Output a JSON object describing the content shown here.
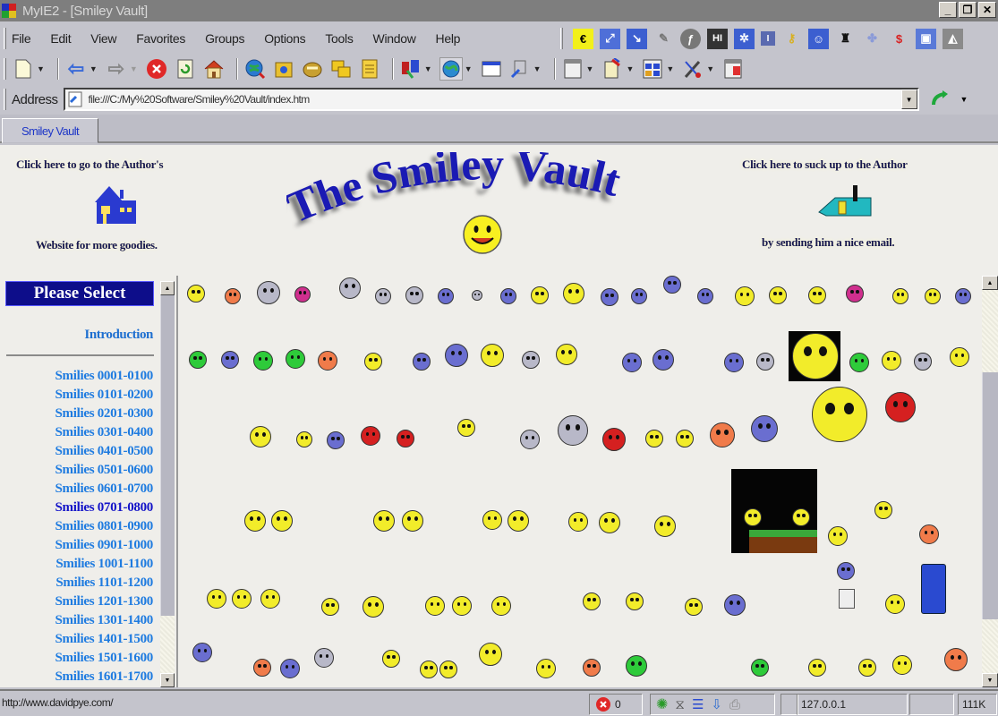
{
  "window": {
    "title": "MyIE2 - [Smiley Vault]",
    "controls": {
      "minimize": "_",
      "restore": "❐",
      "close": "✕"
    }
  },
  "menubar": {
    "items": [
      {
        "label": "File",
        "accel": "F"
      },
      {
        "label": "Edit",
        "accel": "E"
      },
      {
        "label": "View",
        "accel": "V"
      },
      {
        "label": "Favorites",
        "accel": "a"
      },
      {
        "label": "Groups",
        "accel": "G"
      },
      {
        "label": "Options",
        "accel": "O"
      },
      {
        "label": "Tools",
        "accel": "T"
      },
      {
        "label": "Window",
        "accel": "W"
      },
      {
        "label": "Help",
        "accel": "H"
      }
    ],
    "extension_icons": [
      "euro-icon",
      "resize-icon",
      "arrow-icon",
      "mouse-icon",
      "flash-icon",
      "hi-icon",
      "network-icon",
      "info-icon",
      "key-icon",
      "user-icon",
      "spy-icon",
      "puzzle-icon",
      "script-icon",
      "image-icon",
      "proxy-icon"
    ]
  },
  "toolbar": {
    "buttons": [
      "new-window",
      "back",
      "forward",
      "stop",
      "refresh",
      "home",
      "search",
      "favorites",
      "history",
      "groups",
      "notes",
      "popup-filter",
      "web",
      "window-layout",
      "tools",
      "new-tab",
      "view-options",
      "tile",
      "properties",
      "close-tab"
    ]
  },
  "address": {
    "label": "Address",
    "value": "file:///C:/My%20Software/Smiley%20Vault/index.htm"
  },
  "tabs": [
    {
      "label": "Smiley Vault",
      "active": true
    }
  ],
  "page": {
    "left_blurb_top": "Click here to go to the Author's",
    "left_blurb_bottom": "Website for more goodies.",
    "right_blurb_top": "Click here to suck up to the Author",
    "right_blurb_bottom": "by sending him a nice email.",
    "logo_text": "The Smiley Vault",
    "nav": {
      "header": "Please Select",
      "intro": "Introduction",
      "items": [
        {
          "label": "Smilies 0001-0100",
          "visited": false
        },
        {
          "label": "Smilies 0101-0200",
          "visited": false
        },
        {
          "label": "Smilies 0201-0300",
          "visited": false
        },
        {
          "label": "Smilies 0301-0400",
          "visited": false
        },
        {
          "label": "Smilies 0401-0500",
          "visited": false
        },
        {
          "label": "Smilies 0501-0600",
          "visited": false
        },
        {
          "label": "Smilies 0601-0700",
          "visited": false
        },
        {
          "label": "Smilies 0701-0800",
          "visited": true
        },
        {
          "label": "Smilies 0801-0900",
          "visited": false
        },
        {
          "label": "Smilies 0901-1000",
          "visited": false
        },
        {
          "label": "Smilies 1001-1100",
          "visited": false
        },
        {
          "label": "Smilies 1101-1200",
          "visited": false
        },
        {
          "label": "Smilies 1201-1300",
          "visited": false
        },
        {
          "label": "Smilies 1301-1400",
          "visited": false
        },
        {
          "label": "Smilies 1401-1500",
          "visited": false
        },
        {
          "label": "Smilies 1501-1600",
          "visited": false
        },
        {
          "label": "Smilies 1601-1700",
          "visited": false
        }
      ]
    },
    "smiley_colors": {
      "yellow": "#f2ec2a",
      "blue": "#6a6ed0",
      "grey": "#b8b8c8",
      "red": "#d52020",
      "green": "#2ecb3a",
      "pink": "#d02f8e",
      "orange": "#f07b4a"
    }
  },
  "status": {
    "url": "http://www.davidpye.com/",
    "blocked_count": "0",
    "ip": "127.0.0.1",
    "memory": "111K"
  },
  "colors": {
    "link": "#1e7be0",
    "visited_link": "#1414c8",
    "header_bg": "#0d0d8a",
    "logo_blue": "#1a1ab4",
    "page_bg": "#efeeea"
  }
}
